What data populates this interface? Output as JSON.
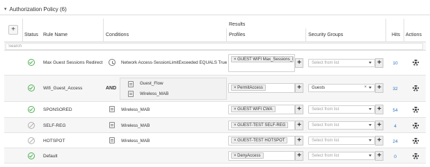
{
  "section": {
    "title": "Authorization Policy (6)",
    "expanded_icon": "chevron-down-icon"
  },
  "header": {
    "add_label": "+",
    "status": "Status",
    "rule_name": "Rule Name",
    "conditions": "Conditions",
    "results_group": "Results",
    "profiles": "Profiles",
    "security_groups": "Security Groups",
    "hits": "Hits",
    "actions": "Actions"
  },
  "search": {
    "placeholder": "Search"
  },
  "rows": [
    {
      "status": "enabled",
      "name": "Max Guest Sessions Redirect",
      "condition_icon": "clock-icon",
      "condition": "Network Access·SessionLimitExceeded  EQUALS  True",
      "profile": "× GUEST WIFI Max_Sessions_Rea",
      "security_group": "Select from list",
      "hits": "10"
    },
    {
      "status": "enabled",
      "name": "Wifi_Guest_Access",
      "operator": "AND",
      "conditions": [
        "Guest_Flow",
        "Wireless_MAB"
      ],
      "profile": "× PermitAccess",
      "security_group": "Guests",
      "hits": "32"
    },
    {
      "status": "enabled",
      "name": "SPONSORED",
      "condition": "Wireless_MAB",
      "profile": "× GUEST WIFI CWA",
      "security_group": "Select from list",
      "hits": "54"
    },
    {
      "status": "disabled",
      "name": "SELF-REG",
      "condition": "Wireless_MAB",
      "profile": "× GUEST-TEST SELF-REG",
      "security_group": "Select from list",
      "hits": "4"
    },
    {
      "status": "disabled",
      "name": "HOTSPOT",
      "condition": "Wireless_MAB",
      "profile": "× GUEST-TEST HOTSPOT",
      "security_group": "Select from list",
      "hits": "24"
    },
    {
      "status": "enabled",
      "name": "Default",
      "condition": "",
      "profile": "× DenyAccess",
      "security_group": "Select from list",
      "hits": "0"
    }
  ],
  "colors": {
    "enabled": "#4caf50",
    "disabled": "#b0b0b0",
    "hits_link": "#2f74c0"
  }
}
